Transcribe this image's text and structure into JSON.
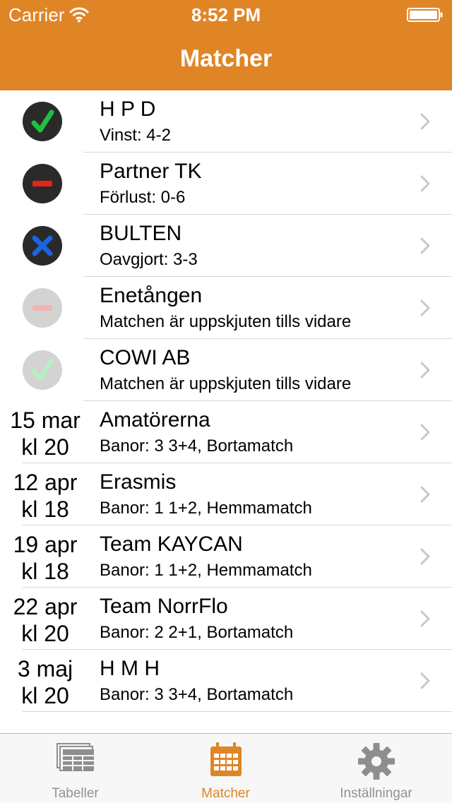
{
  "status_bar": {
    "carrier": "Carrier",
    "time": "8:52 PM"
  },
  "nav": {
    "title": "Matcher"
  },
  "results": [
    {
      "team": "H P D",
      "detail": "Vinst: 4-2",
      "icon": "check-icon",
      "faded": false
    },
    {
      "team": "Partner TK",
      "detail": "Förlust: 0-6",
      "icon": "minus-icon",
      "faded": false
    },
    {
      "team": "BULTEN",
      "detail": "Oavgjort: 3-3",
      "icon": "cross-icon",
      "faded": false
    },
    {
      "team": "Enetången",
      "detail": "Matchen är uppskjuten tills vidare",
      "icon": "minus-icon",
      "faded": true
    },
    {
      "team": "COWI AB",
      "detail": "Matchen är uppskjuten tills vidare",
      "icon": "check-icon",
      "faded": true
    }
  ],
  "upcoming": [
    {
      "date": "15 mar",
      "time": "kl 20",
      "team": "Amatörerna",
      "detail": "Banor: 3  3+4, Bortamatch"
    },
    {
      "date": "12 apr",
      "time": "kl 18",
      "team": "Erasmis",
      "detail": "Banor: 1  1+2, Hemmamatch"
    },
    {
      "date": "19 apr",
      "time": "kl 18",
      "team": "Team   KAYCAN",
      "detail": "Banor: 1  1+2, Hemmamatch"
    },
    {
      "date": "22 apr",
      "time": "kl 20",
      "team": "Team   NorrFlo",
      "detail": "Banor: 2  2+1, Bortamatch"
    },
    {
      "date": "3 maj",
      "time": "kl 20",
      "team": "H M H",
      "detail": "Banor: 3  3+4, Bortamatch"
    }
  ],
  "tabs": [
    {
      "label": "Tabeller",
      "icon": "tables-icon",
      "active": false
    },
    {
      "label": "Matcher",
      "icon": "calendar-icon",
      "active": true
    },
    {
      "label": "Inställningar",
      "icon": "gear-icon",
      "active": false
    }
  ],
  "colors": {
    "accent": "#e08526",
    "win": "#1fbf3f",
    "loss": "#e8231b",
    "draw": "#1e63e0",
    "faded_win": "#b8efbf",
    "faded_loss": "#f2b3b3"
  }
}
